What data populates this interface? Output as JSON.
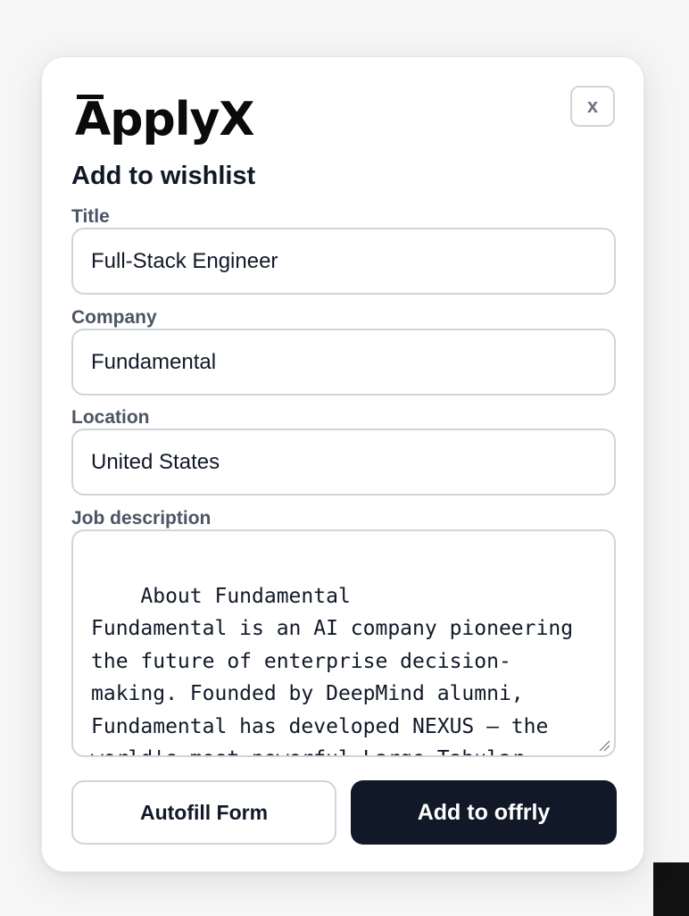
{
  "logo": {
    "text": "ApplyX"
  },
  "close_button": {
    "label": "x"
  },
  "heading": "Add to wishlist",
  "fields": {
    "title": {
      "label": "Title",
      "value": "Full-Stack Engineer"
    },
    "company": {
      "label": "Company",
      "value": "Fundamental"
    },
    "location": {
      "label": "Location",
      "value": "United States"
    },
    "description": {
      "label": "Job description",
      "value": "About Fundamental\nFundamental is an AI company pioneering the future of enterprise decision-making. Founded by DeepMind alumni, Fundamental has developed NEXUS — the world's most powerful Large Tabular Model (LTM) — purpose-built for enterprise data."
    }
  },
  "buttons": {
    "autofill": "Autofill Form",
    "add": "Add to offrly"
  },
  "colors": {
    "primary": "#111827",
    "border": "#d1d5db",
    "label": "#4b5563"
  }
}
